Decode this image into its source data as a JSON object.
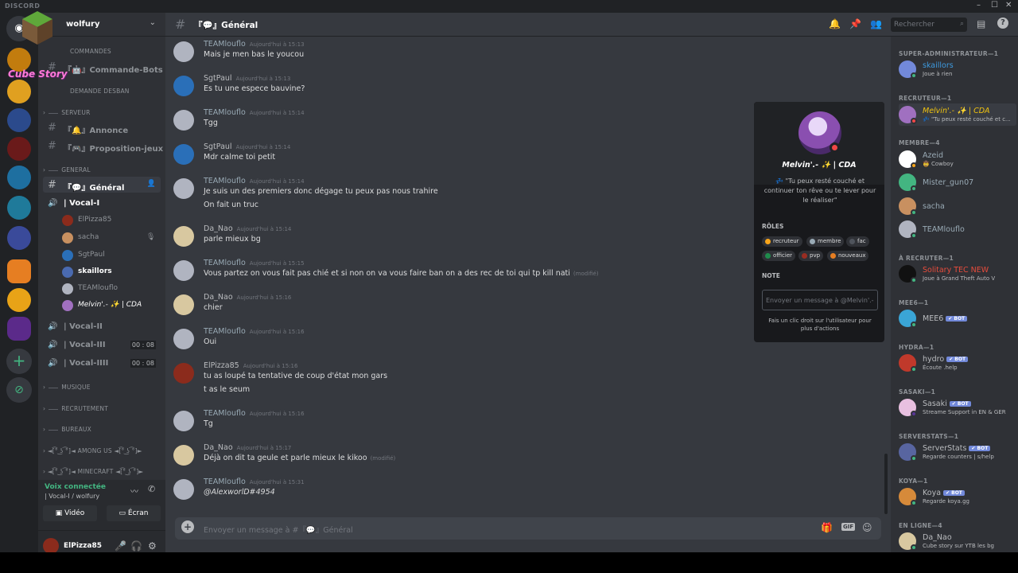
{
  "app": {
    "name": "DISCORD",
    "colors": {
      "accent": "#7289da",
      "online": "#43b581",
      "dnd": "#f04747",
      "idle": "#faa61a"
    }
  },
  "guild": {
    "name": "wolfury",
    "brand_text": "Cube Story"
  },
  "categories": {
    "commandes": "COMMANDES",
    "demande_desban": "DEMANDE DESBAN",
    "serveur": "SERVEUR",
    "general": "GENERAL",
    "musique": "MUSIQUE",
    "recrutement": "RECRUTEMENT",
    "bureaux": "BUREAUX",
    "among_us": "◄[͡° ͜ʖ ͡°]◄ AMONG US ◄[͡° ͜ʖ ͡°]►",
    "minecraft": "◄[͡° ͜ʖ ͡°]◄ MINECRAFT ◄[͡° ͜ʖ ͡°]►"
  },
  "channels": {
    "commande_bots": "『🤖』Commande-Bots",
    "annonce": "『🔔』Annonce",
    "proposition": "『🎮』Proposition-jeux",
    "general": "『💬』Général",
    "vocal1": "| Vocal-I",
    "vocal2": "| Vocal-II",
    "vocal3": "| Vocal-III",
    "vocal4": "| Vocal-IIII",
    "timer3": "00 : 08",
    "timer4": "00 : 08"
  },
  "voice_users": [
    "ElPizza85",
    "sacha",
    "SgtPaul",
    "skaillors",
    "TEAMlouflo",
    "Melvin'.- ✨ | CDA"
  ],
  "voice_panel": {
    "title": "Voix connectée",
    "sub": "| Vocal-I / wolfury",
    "video": "Vidéo",
    "screen": "Écran"
  },
  "user_panel": {
    "name": "ElPizza85"
  },
  "chat": {
    "channel_title": "『💬』Général",
    "search_placeholder": "Rechercher",
    "composer_placeholder": "Envoyer un message à #『💬』Général",
    "messages": [
      {
        "author": "TEAMlouflo",
        "time": "Aujourd'hui à 15:13",
        "lines": [
          "Mais je men bas le youcou"
        ]
      },
      {
        "author": "SgtPaul",
        "time": "Aujourd'hui à 15:13",
        "lines": [
          "Es tu une espece bauvine?"
        ]
      },
      {
        "author": "TEAMlouflo",
        "time": "Aujourd'hui à 15:14",
        "lines": [
          "Tgg"
        ]
      },
      {
        "author": "SgtPaul",
        "time": "Aujourd'hui à 15:14",
        "lines": [
          "Mdr calme toi petit"
        ]
      },
      {
        "author": "TEAMlouflo",
        "time": "Aujourd'hui à 15:14",
        "lines": [
          "Je suis un des premiers donc dégage tu peux pas nous trahire",
          "On fait un truc"
        ]
      },
      {
        "author": "Da_Nao",
        "time": "Aujourd'hui à 15:14",
        "lines": [
          "parle mieux bg"
        ]
      },
      {
        "author": "TEAMlouflo",
        "time": "Aujourd'hui à 15:15",
        "lines": [
          "Vous partez on vous fait pas chié et si non on va vous faire ban on a des rec de toi qui tp kill nati"
        ],
        "edited": "(modifié)"
      },
      {
        "author": "Da_Nao",
        "time": "Aujourd'hui à 15:16",
        "lines": [
          "chier"
        ]
      },
      {
        "author": "TEAMlouflo",
        "time": "Aujourd'hui à 15:16",
        "lines": [
          "Oui"
        ]
      },
      {
        "author": "ElPizza85",
        "time": "Aujourd'hui à 15:16",
        "lines": [
          "tu as loupé ta tentative de coup d'état mon gars",
          "t as le seum"
        ]
      },
      {
        "author": "TEAMlouflo",
        "time": "Aujourd'hui à 15:16",
        "lines": [
          "Tg"
        ]
      },
      {
        "author": "Da_Nao",
        "time": "Aujourd'hui à 15:17",
        "lines": [
          "Déjà on dit ta geule et parle mieux le kikoo"
        ],
        "edited": "(modifié)"
      },
      {
        "author": "TEAMlouflo",
        "time": "Aujourd'hui à 15:31",
        "lines": [
          "@AlexworlD#4954"
        ]
      }
    ]
  },
  "popout": {
    "name": "Melvin'.- ✨ | CDA",
    "status": "💤 \"Tu peux resté couché et continuer ton rêve ou te lever pour le réaliser\"",
    "roles_label": "RÔLES",
    "roles": [
      "recruteur",
      "membre",
      "fac",
      "officier",
      "pvp",
      "nouveaux"
    ],
    "note_label": "NOTE",
    "note_placeholder": "Envoyer un message à @Melvin'.-",
    "footer": "Fais un clic droit sur l'utilisateur pour plus d'actions"
  },
  "members": {
    "groups": {
      "superadmin": "SUPER-ADMINISTRATEUR—1",
      "recruteur": "RECRUTEUR—1",
      "membre": "MEMBRE—4",
      "a_recruter": "À RECRUTER—1",
      "mee6": "MEE6—1",
      "hydra": "HYDRA—1",
      "sasaki": "SASAKI—1",
      "serverstats": "SERVERSTATS—1",
      "koya": "KOYA—1",
      "en_ligne": "EN LIGNE—4"
    },
    "list": [
      {
        "name": "skaillors",
        "status": "Joue à rien"
      },
      {
        "name": "Melvin'.- ✨ | CDA",
        "status": "💤 \"Tu peux resté couché et c..."
      },
      {
        "name": "Azeid",
        "status": "🤠 Cowboy"
      },
      {
        "name": "Mister_gun07",
        "status": ""
      },
      {
        "name": "sacha",
        "status": ""
      },
      {
        "name": "TEAMlouflo",
        "status": ""
      },
      {
        "name": "Solitary TEC NEW",
        "status": "Joue à Grand Theft Auto V"
      },
      {
        "name": "MEE6",
        "status": ""
      },
      {
        "name": "hydro",
        "status": "Écoute .help"
      },
      {
        "name": "Sasaki",
        "status": "Streame Support in EN & GER"
      },
      {
        "name": "ServerStats",
        "status": "Regarde counters | s/help"
      },
      {
        "name": "Koya",
        "status": "Regarde koya.gg"
      },
      {
        "name": "Da_Nao",
        "status": "Cube story sur YTB les bg"
      }
    ],
    "bot_tag": "✔ BOT"
  },
  "icons": [
    "bell-icon",
    "pin-icon",
    "members-icon",
    "search-icon",
    "inbox-icon",
    "help-icon",
    "mic-icon",
    "headphones-icon",
    "gear-icon",
    "gift-icon",
    "gif-icon",
    "emoji-icon"
  ]
}
